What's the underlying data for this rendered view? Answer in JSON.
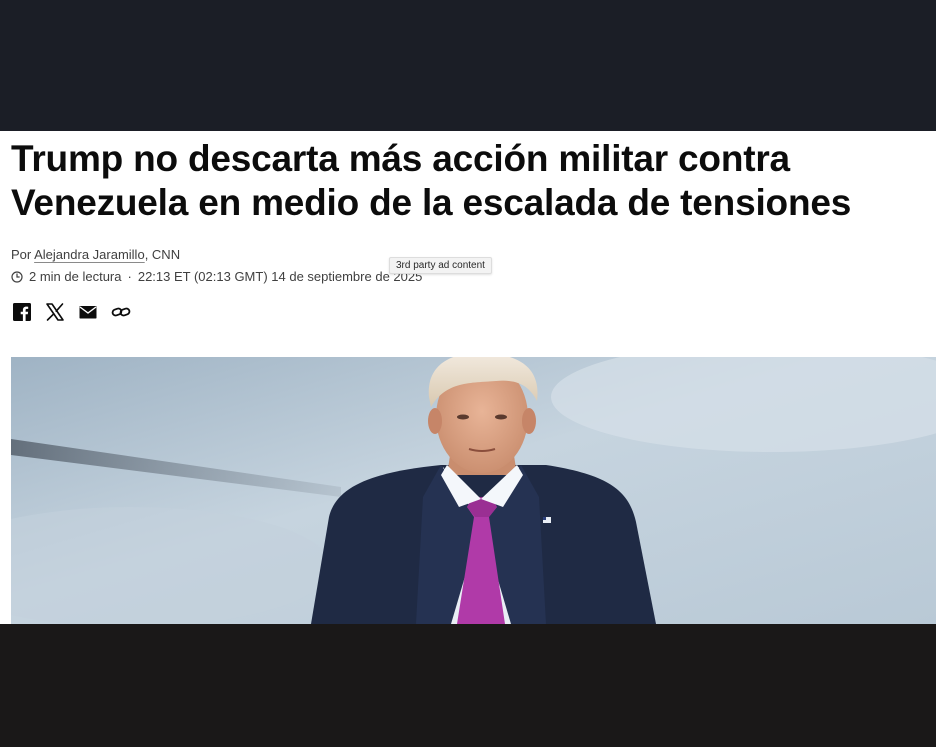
{
  "article": {
    "headline": "Trump no descarta más acción militar contra Venezuela en medio de la escalada de tensiones",
    "byline_prefix": "Por ",
    "author": "Alejandra Jaramillo",
    "source": ", CNN",
    "read_time": "2 min de lectura",
    "separator": "·",
    "timestamp": "22:13 ET (02:13 GMT) 14 de septiembre de 2025",
    "tooltip": "3rd party ad content",
    "share_icons": [
      "facebook-icon",
      "x-icon",
      "email-icon",
      "link-icon"
    ],
    "hero_image": "photo-man-in-suit-pink-tie"
  },
  "colors": {
    "headline": "#0c0c0c",
    "meta_text": "#404040",
    "top_band": "#1b1e26",
    "bottom_band": "#1a1818",
    "tie": "#b03aa8",
    "suit": "#1f2a44"
  }
}
